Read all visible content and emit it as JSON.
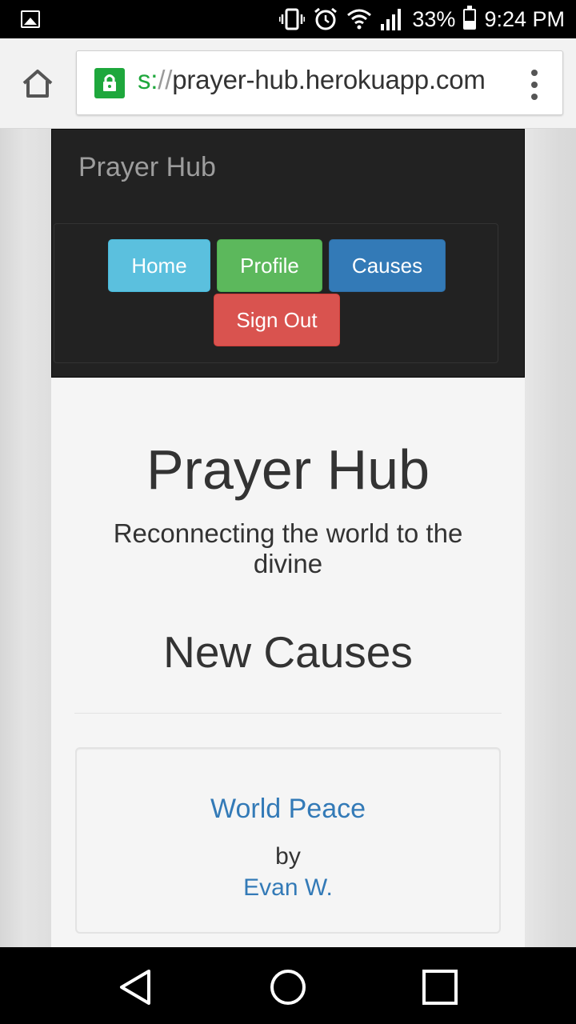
{
  "status_bar": {
    "battery": "33%",
    "time": "9:24 PM",
    "icons": [
      "gallery-icon",
      "vibrate-icon",
      "alarm-icon",
      "wifi-icon",
      "signal-icon",
      "battery-icon"
    ]
  },
  "browser": {
    "url_scheme": "s:",
    "url_sep": "//",
    "url_host": "prayer-hub.herokuapp.com",
    "accent": "#1ea73c"
  },
  "navbar": {
    "brand": "Prayer Hub",
    "buttons": [
      {
        "label": "Home",
        "color": "#5bc0de"
      },
      {
        "label": "Profile",
        "color": "#5cb85c"
      },
      {
        "label": "Causes",
        "color": "#337ab7"
      },
      {
        "label": "Sign Out",
        "color": "#d9534f"
      }
    ]
  },
  "hero": {
    "title": "Prayer Hub",
    "subtitle": "Reconnecting the world to the divine"
  },
  "section": {
    "title": "New Causes"
  },
  "causes": [
    {
      "title": "World Peace",
      "by": "by",
      "author": "Evan W."
    }
  ],
  "colors": {
    "link": "#337ab7",
    "navbar_bg": "#222222"
  }
}
